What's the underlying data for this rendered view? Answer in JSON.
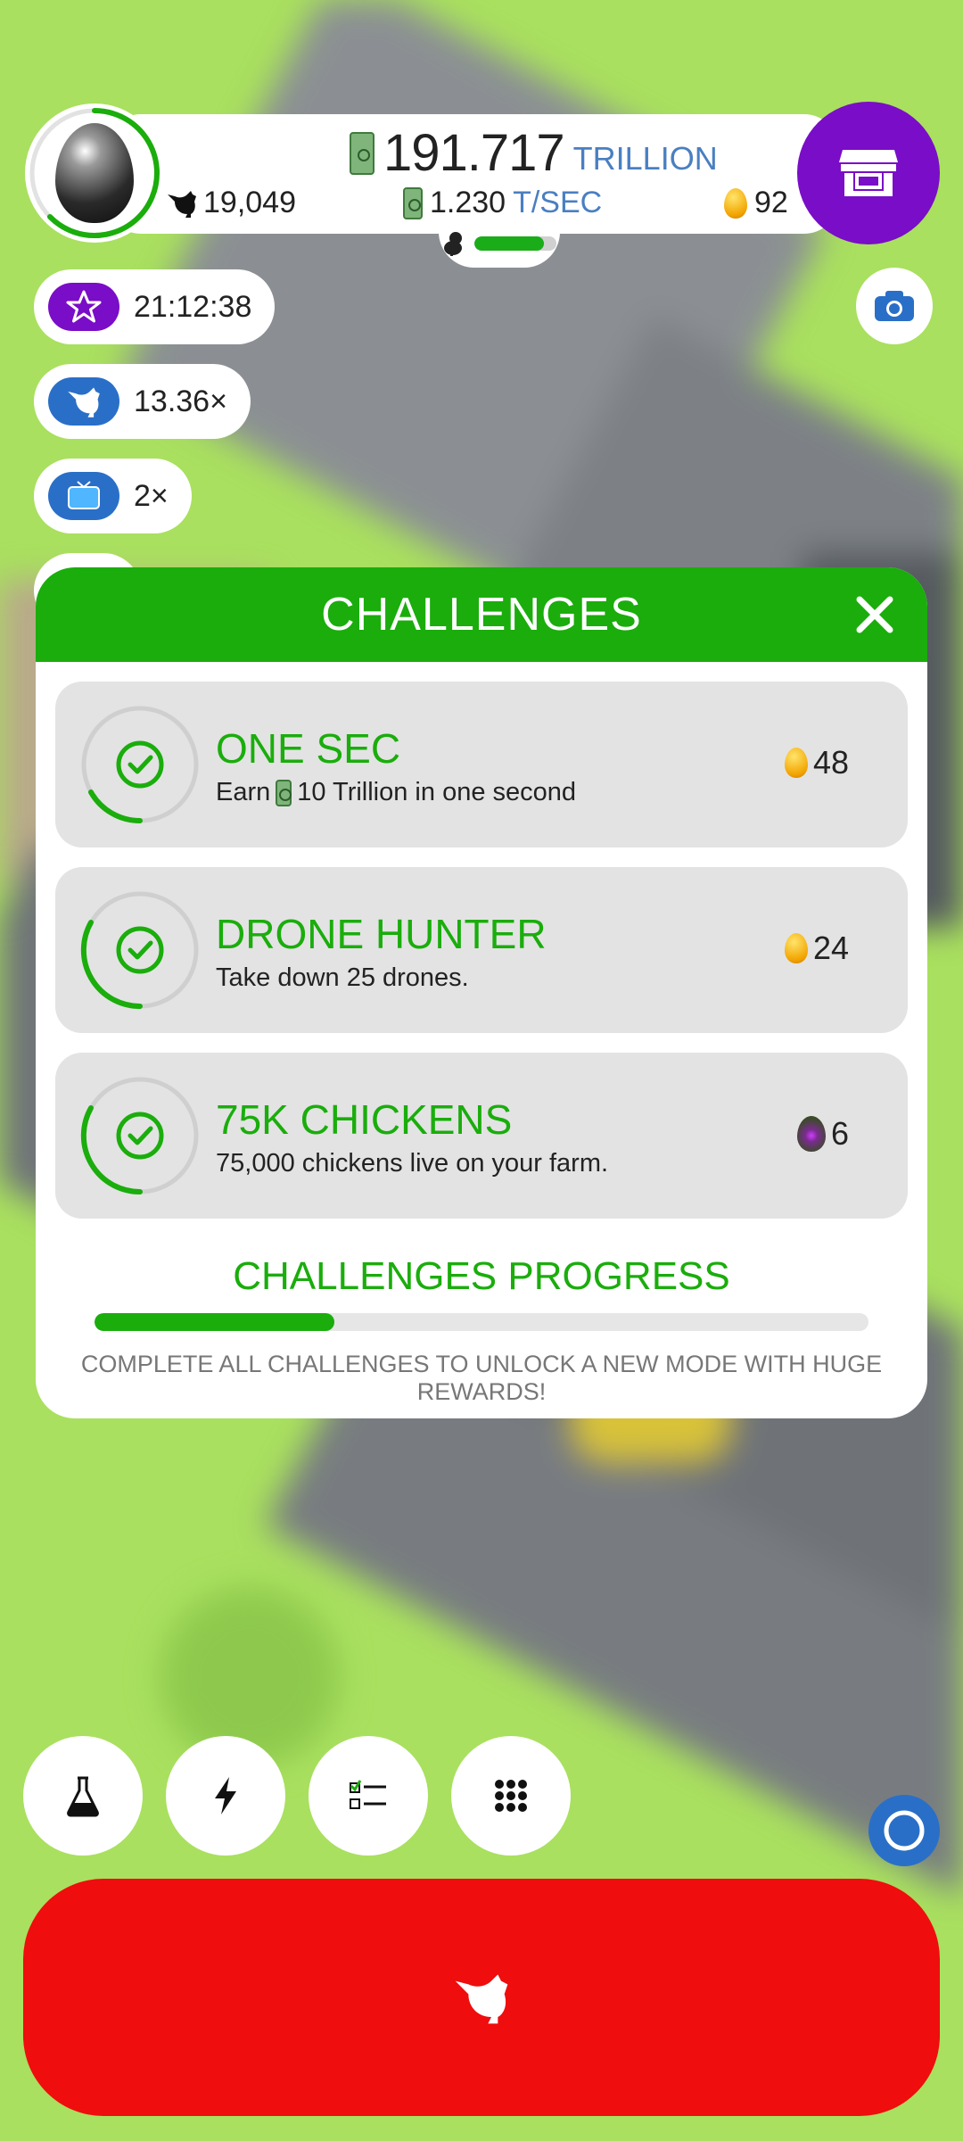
{
  "header": {
    "money_amount": "191.717",
    "money_unit": "TRILLION",
    "rate_amount": "1.230",
    "rate_unit": "T/SEC",
    "chickens": "19,049",
    "golden_eggs": "92",
    "hab_progress": 0.85
  },
  "boosts": [
    {
      "icon": "star-icon",
      "value": "21:12:38",
      "color": "#7a0dc7"
    },
    {
      "icon": "chicken-icon",
      "value": "13.36×",
      "color": "#2a6fc7"
    },
    {
      "icon": "tv-icon",
      "value": "2×",
      "color": "#2a6fc7"
    }
  ],
  "modal": {
    "title": "CHALLENGES",
    "challenges": [
      {
        "title": "ONE SEC",
        "desc_prefix": "Earn",
        "desc": "10 Trillion in one second",
        "reward": "48",
        "reward_type": "gold-egg",
        "progress": 0.3
      },
      {
        "title": "DRONE HUNTER",
        "desc_prefix": "",
        "desc": "Take down 25 drones.",
        "reward": "24",
        "reward_type": "gold-egg",
        "progress": 0.3
      },
      {
        "title": "75K CHICKENS",
        "desc_prefix": "",
        "desc": "75,000 chickens live on your farm.",
        "reward": "6",
        "reward_type": "prophecy-egg",
        "progress": 0.3
      }
    ],
    "progress_title": "CHALLENGES PROGRESS",
    "progress_value": 0.31,
    "progress_note": "COMPLETE ALL CHALLENGES TO UNLOCK A NEW MODE WITH HUGE REWARDS!"
  },
  "colors": {
    "accent_green": "#1aad0c",
    "shop_purple": "#7a0dc7",
    "hatch_red": "#ef0d0d",
    "background_green": "#a9e05f"
  }
}
